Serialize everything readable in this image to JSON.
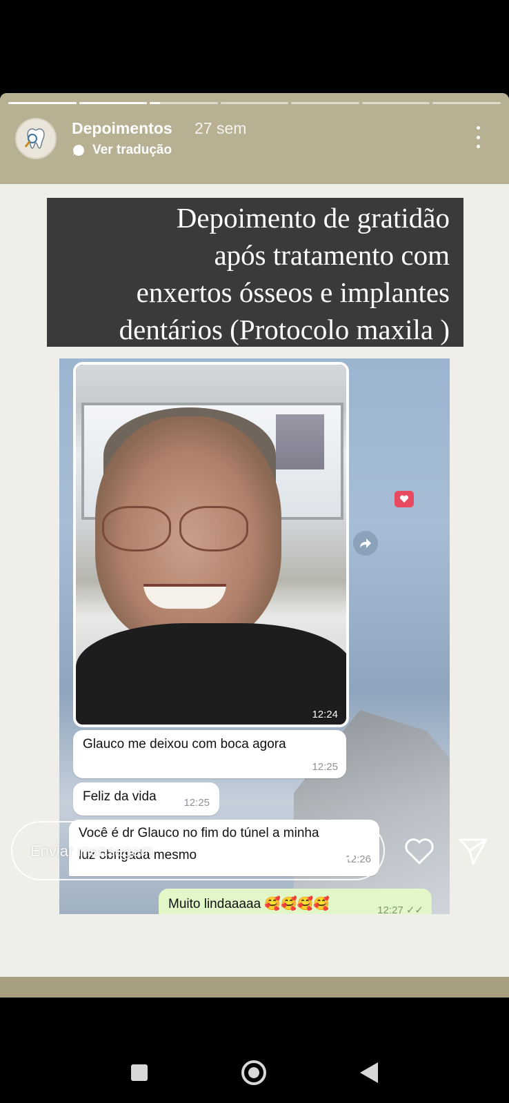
{
  "story": {
    "progress": {
      "segments": 7,
      "active_index": 2,
      "active_fraction": 0.15
    },
    "header": {
      "account_name": "Depoimentos",
      "time_ago": "27 sem",
      "translate_label": "Ver tradução",
      "avatar_icon": "tooth-logo-icon",
      "more_icon": "more-vertical-icon"
    },
    "title_lines": [
      "Depoimento de gratidão",
      "após tratamento com",
      "enxertos ósseos e implantes",
      "dentários (Protocolo maxila )"
    ],
    "chat": {
      "photo_time": "12:24",
      "messages": [
        {
          "text": "Glauco me deixou com boca agora",
          "time": "12:25"
        },
        {
          "text": "Feliz da vida",
          "time": "12:25"
        },
        {
          "text_line1": "Você é dr Glauco no fim do túnel  a minha",
          "text_line2": "luz obrigada mesmo",
          "time": "12:26"
        }
      ],
      "sent": {
        "text": "Muito lindaaaaa 🥰🥰🥰🥰",
        "time": "12:27 ✓✓"
      }
    },
    "reply": {
      "placeholder": "Enviar mensagem",
      "mic_icon": "microphone-icon",
      "like_icon": "heart-icon",
      "send_icon": "send-icon"
    }
  },
  "system_nav": {
    "recents": "recents-icon",
    "home": "home-icon",
    "back": "back-icon"
  },
  "colors": {
    "frame": "#b7b093",
    "title_bg": "#3a3a3a",
    "sent_bubble": "#e1f7c8",
    "react": "#e84a5f"
  }
}
